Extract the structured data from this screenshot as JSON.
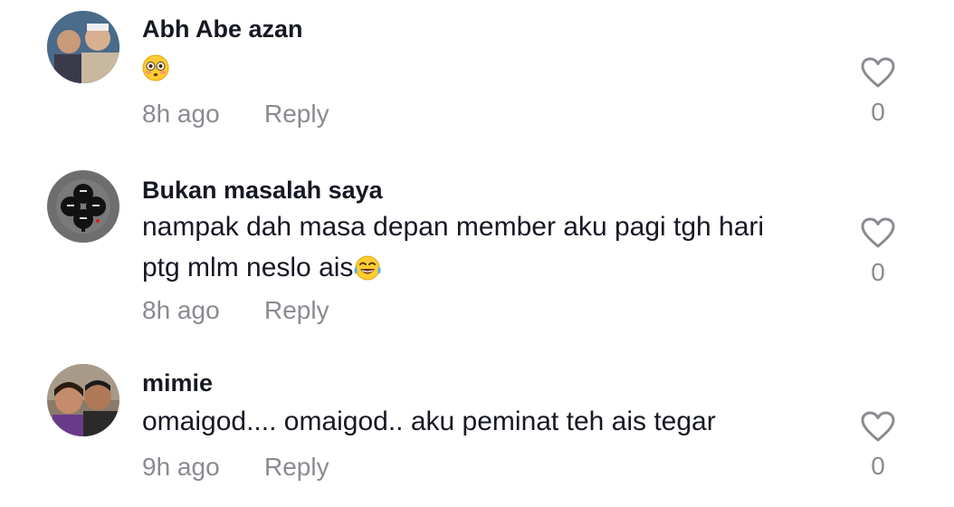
{
  "comments": [
    {
      "username": "Abh Abe azan",
      "text": "",
      "emoji": "flushed-face",
      "time": "8h ago",
      "reply_label": "Reply",
      "like_count": "0"
    },
    {
      "username": "Bukan masalah saya",
      "text_line1": "nampak dah masa depan member aku pagi tgh hari",
      "text_line2": "ptg mlm neslo ais",
      "emoji": "face-with-tears-of-joy",
      "time": "8h ago",
      "reply_label": "Reply",
      "like_count": "0"
    },
    {
      "username": "mimie",
      "text": "omaigod.... omaigod.. aku peminat teh ais tegar",
      "time": "9h ago",
      "reply_label": "Reply",
      "like_count": "0"
    }
  ],
  "colors": {
    "primary_text": "#161823",
    "secondary_text": "#8a8b91",
    "background": "#ffffff"
  },
  "icons": [
    "heart-icon",
    "flushed-face-emoji",
    "tears-of-joy-emoji"
  ]
}
